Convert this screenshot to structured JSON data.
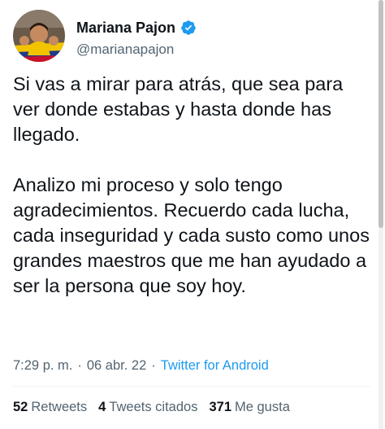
{
  "author": {
    "display_name": "Mariana Pajon",
    "handle": "@marianapajon",
    "verified_icon": "verified-badge-icon",
    "accent_color": "#1d9bf0"
  },
  "tweet": {
    "paragraph_1": "Si vas a mirar para atrás, que sea para ver donde estabas y hasta donde has llegado.",
    "paragraph_2": "Analizo mi proceso y solo tengo agradecimientos. Recuerdo cada lucha, cada inseguridad y cada susto como unos grandes maestros que me han ayudado a ser la persona que soy hoy."
  },
  "meta": {
    "time": "7:29 p. m.",
    "separator": "·",
    "date": "06 abr. 22",
    "source": "Twitter for Android"
  },
  "stats": {
    "retweets_count": "52",
    "retweets_label": "Retweets",
    "quotes_count": "4",
    "quotes_label": "Tweets citados",
    "likes_count": "371",
    "likes_label": "Me gusta"
  }
}
